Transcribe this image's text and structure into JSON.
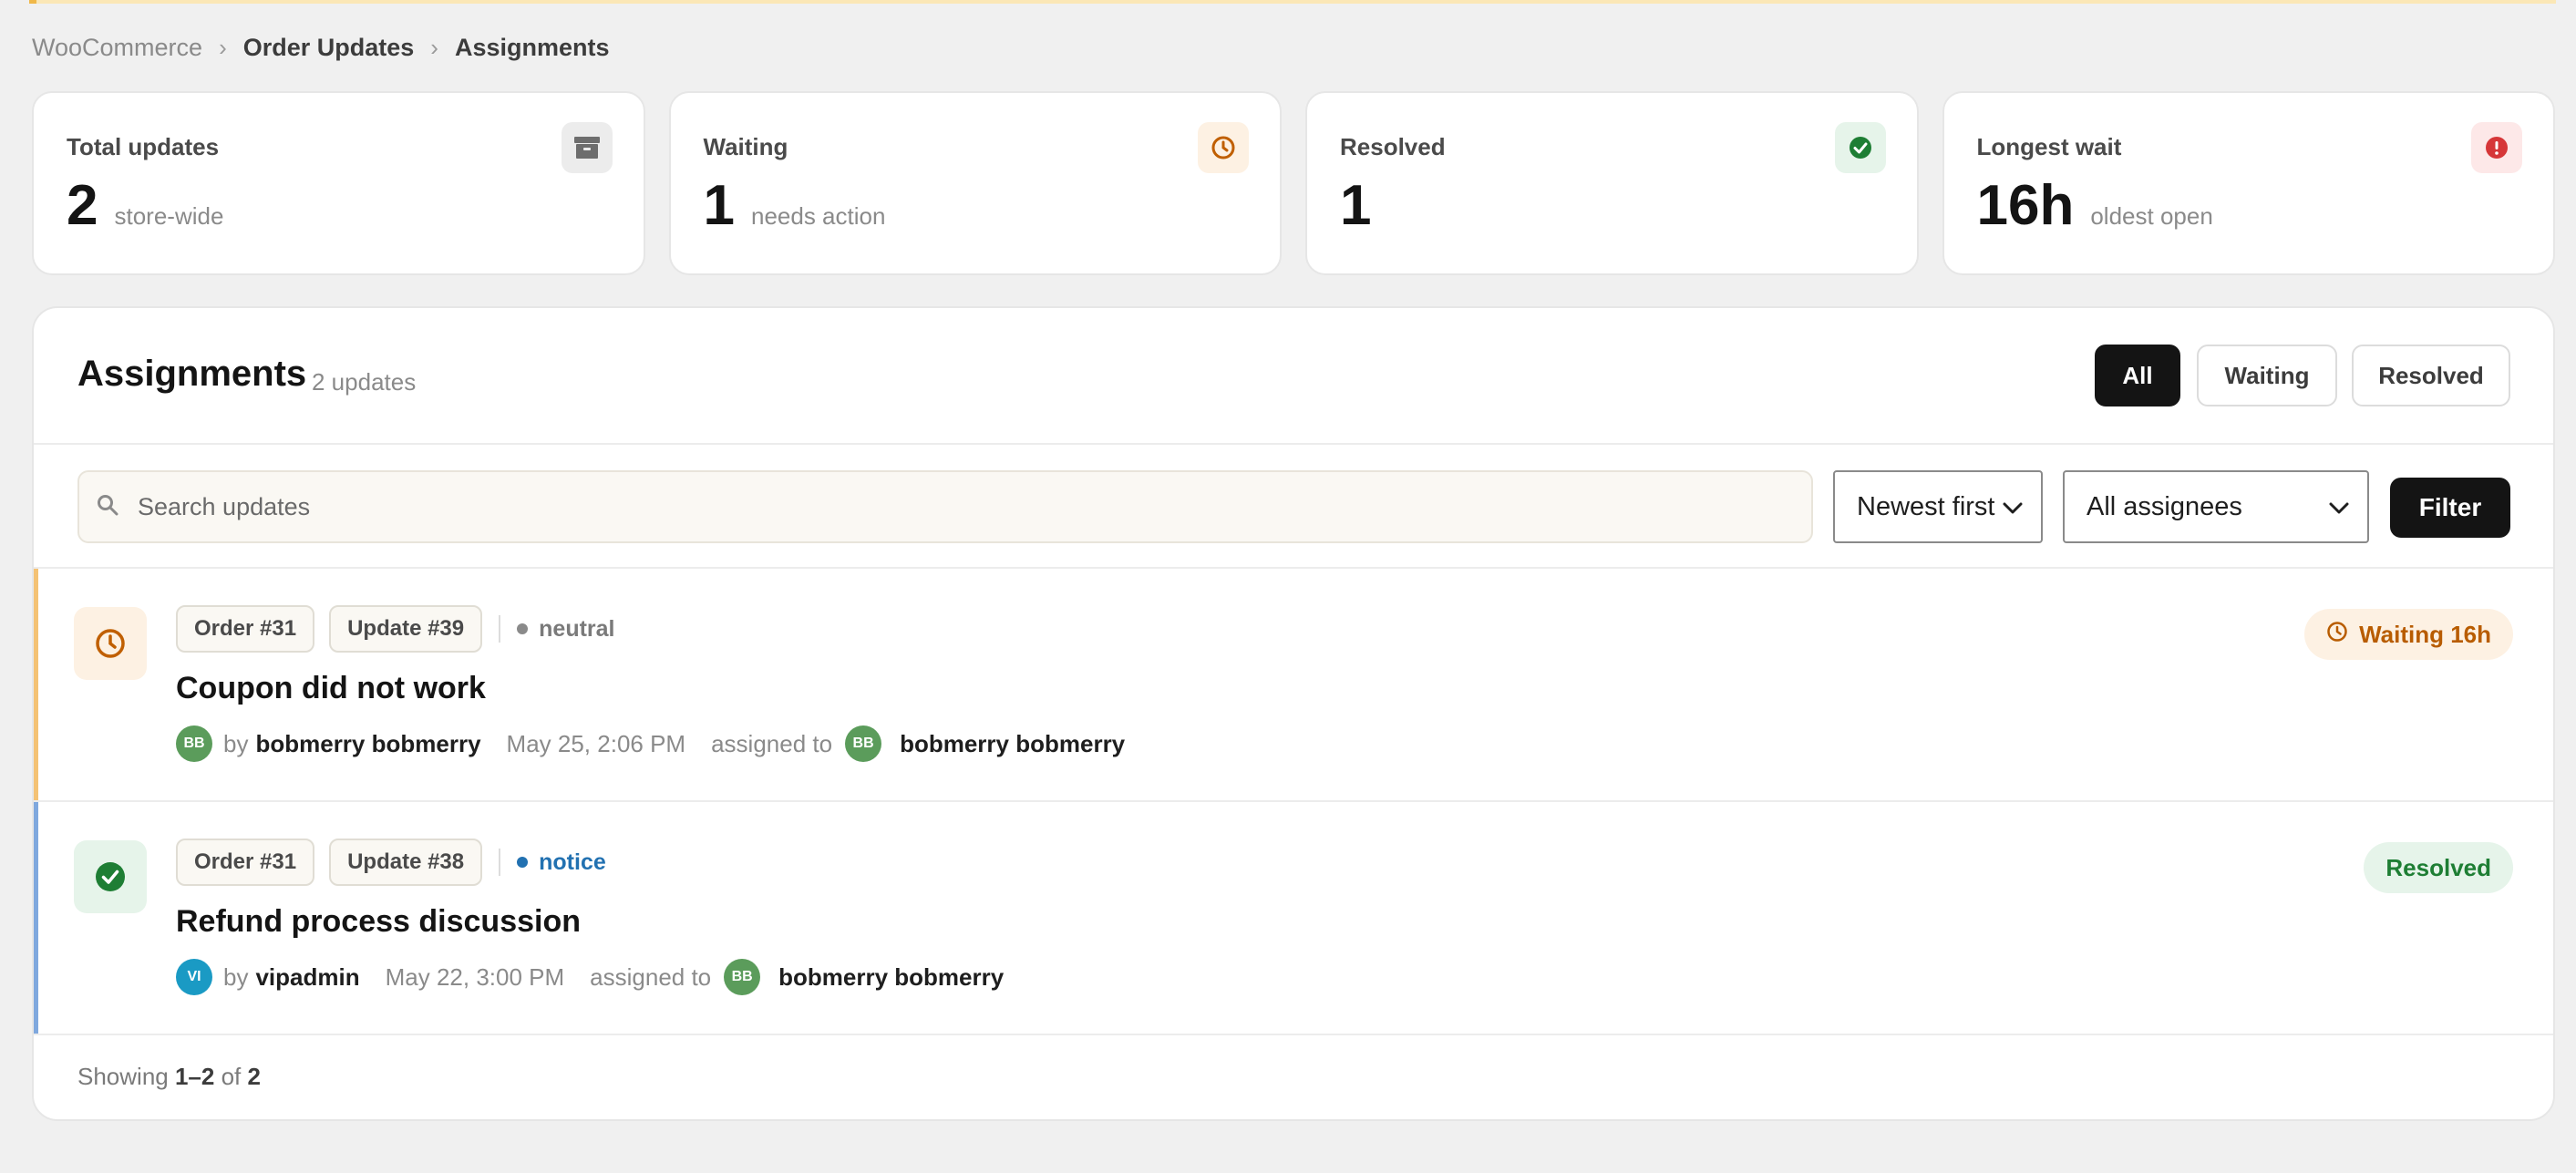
{
  "breadcrumb": {
    "root": "WooCommerce",
    "section": "Order Updates",
    "current": "Assignments",
    "separator": "›"
  },
  "stats": [
    {
      "label": "Total updates",
      "value": "2",
      "sub": "store-wide",
      "icon": "archive-icon"
    },
    {
      "label": "Waiting",
      "value": "1",
      "sub": "needs action",
      "icon": "clock-icon"
    },
    {
      "label": "Resolved",
      "value": "1",
      "sub": "",
      "icon": "check-circle-icon"
    },
    {
      "label": "Longest wait",
      "value": "16h",
      "sub": "oldest open",
      "icon": "alert-icon"
    }
  ],
  "panel": {
    "title": "Assignments",
    "count": "2 updates",
    "tabs": [
      "All",
      "Waiting",
      "Resolved"
    ],
    "active_tab": "All"
  },
  "toolbar": {
    "search_placeholder": "Search updates",
    "sort_value": "Newest first",
    "assignee_value": "All assignees",
    "filter_label": "Filter"
  },
  "items": [
    {
      "order": "Order #31",
      "update": "Update #39",
      "level": "neutral",
      "title": "Coupon did not work",
      "by_label": "by",
      "author_initials": "BB",
      "author": "bobmerry bobmerry",
      "date": "May 25, 2:06 PM",
      "assigned_label": "assigned to",
      "assignee_initials": "BB",
      "assignee": "bobmerry bobmerry",
      "status": "Waiting 16h"
    },
    {
      "order": "Order #31",
      "update": "Update #38",
      "level": "notice",
      "title": "Refund process discussion",
      "by_label": "by",
      "author_initials": "VI",
      "author": "vipadmin",
      "date": "May 22, 3:00 PM",
      "assigned_label": "assigned to",
      "assignee_initials": "BB",
      "assignee": "bobmerry bobmerry",
      "status": "Resolved"
    }
  ],
  "footer": {
    "prefix": "Showing",
    "range": "1–2",
    "of": "of",
    "total": "2"
  },
  "colors": {
    "waiting": "#b85c00",
    "resolved": "#1e7e34",
    "notice": "#2271b1",
    "primary": "#141414"
  }
}
